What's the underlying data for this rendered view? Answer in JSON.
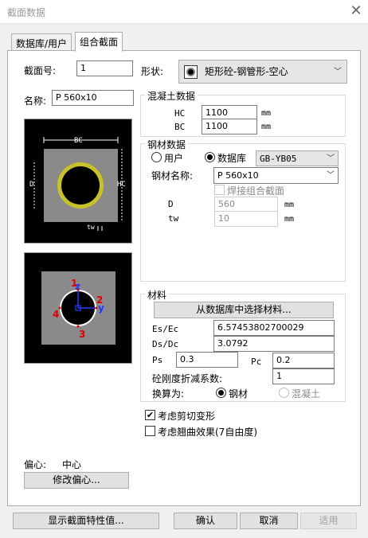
{
  "window": {
    "title": "截面数据",
    "close_glyph": "✕"
  },
  "tabs": [
    "数据库/用户",
    "组合截面"
  ],
  "section": {
    "number_label": "截面号:",
    "number_value": "1",
    "shape_label": "形状:",
    "shape_value": "矩形砼-钢管形-空心",
    "name_label": "名称:",
    "name_value": "P 560x10"
  },
  "concrete": {
    "title": "混凝土数据",
    "hc_label": "HC",
    "hc_value": "1100",
    "bc_label": "BC",
    "bc_value": "1100",
    "unit": "mm"
  },
  "steel": {
    "title": "钢材数据",
    "user_label": "用户",
    "db_label": "数据库",
    "db_value": "GB-YB05",
    "name_label": "钢材名称:",
    "name_value": "P 560x10",
    "weld_label": "焊接组合截面",
    "d_label": "D",
    "d_value": "560",
    "tw_label": "tw",
    "tw_value": "10",
    "unit": "mm"
  },
  "drawing1": {
    "bc": "BC",
    "d": "D",
    "hc": "HC",
    "tw": "tw"
  },
  "drawing2": {
    "n1": "1",
    "n2": "2",
    "n3": "3",
    "n4": "4",
    "z": "z",
    "y": "y"
  },
  "material": {
    "title": "材料",
    "select_button": "从数据库中选择材料...",
    "es_ec_label": "Es/Ec",
    "es_ec_value": "6.57453802700029",
    "ds_dc_label": "Ds/Dc",
    "ds_dc_value": "3.0792",
    "ps_label": "Ps",
    "ps_value": "0.3",
    "pc_label": "Pc",
    "pc_value": "0.2",
    "stiffness_label": "砼刚度折减系数:",
    "stiffness_value": "1",
    "convert_label": "换算为:",
    "steel_option": "钢材",
    "concrete_option": "混凝土"
  },
  "options": {
    "shear_label": "考虑剪切变形",
    "warping_label": "考虑翘曲效果(7自由度)"
  },
  "eccentricity": {
    "label": "偏心:",
    "value": "中心",
    "modify_button": "修改偏心..."
  },
  "footer": {
    "show_props": "显示截面特性值...",
    "ok": "确认",
    "cancel": "取消",
    "apply": "适用"
  },
  "colors": {
    "ring": "#c8c22a",
    "concrete_fill": "#8a8a8a",
    "node_red": "#e00000",
    "axis_blue": "#1e3cff"
  }
}
